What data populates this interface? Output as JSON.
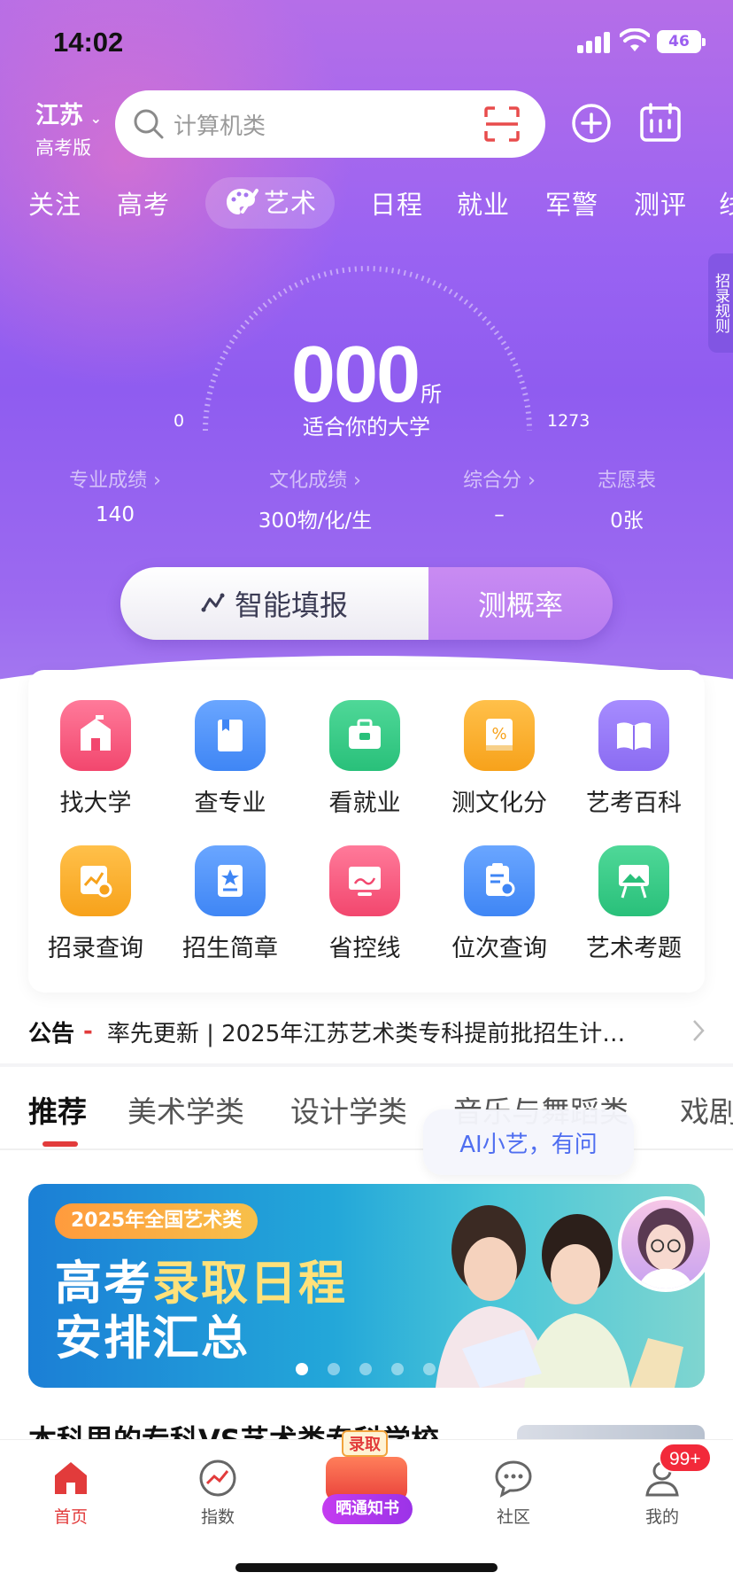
{
  "status_bar": {
    "time": "14:02",
    "battery": "46"
  },
  "header": {
    "region": "江苏",
    "edition": "高考版",
    "search_placeholder": "计算机类"
  },
  "top_tabs": [
    "关注",
    "高考",
    "艺术",
    "日程",
    "就业",
    "军警",
    "测评",
    "线"
  ],
  "active_top_tab": "艺术",
  "side_rule_label": "招录规则",
  "gauge": {
    "count": "000",
    "unit": "所",
    "subtitle": "适合你的大学",
    "min": "0",
    "max": "1273"
  },
  "stats": [
    {
      "label": "专业成绩 ›",
      "value": "140"
    },
    {
      "label": "文化成绩 ›",
      "value": "300物/化/生"
    },
    {
      "label": "综合分 ›",
      "value": "–"
    },
    {
      "label": "志愿表",
      "value": "0张"
    }
  ],
  "cta": {
    "left_label": "智能填报",
    "right_label": "测概率"
  },
  "grid": [
    {
      "label": "找大学",
      "icon": "school-icon",
      "color": "#f2476e"
    },
    {
      "label": "查专业",
      "icon": "book-icon",
      "color": "#3f86f5"
    },
    {
      "label": "看就业",
      "icon": "briefcase-icon",
      "color": "#29c07a"
    },
    {
      "label": "测文化分",
      "icon": "percent-book-icon",
      "color": "#f7a21b"
    },
    {
      "label": "艺考百科",
      "icon": "open-book-icon",
      "color": "#8b6cf2"
    },
    {
      "label": "招录查询",
      "icon": "chart-search-icon",
      "color": "#f7a21b"
    },
    {
      "label": "招生简章",
      "icon": "star-doc-icon",
      "color": "#3f86f5"
    },
    {
      "label": "省控线",
      "icon": "monitor-icon",
      "color": "#f2476e"
    },
    {
      "label": "位次查询",
      "icon": "clipboard-search-icon",
      "color": "#3f86f5"
    },
    {
      "label": "艺术考题",
      "icon": "easel-icon",
      "color": "#29c07a"
    }
  ],
  "notice": {
    "tag": "公告",
    "dash": "-",
    "text": "率先更新 | 2025年江苏艺术类专科提前批招生计…"
  },
  "sub_tabs": [
    "推荐",
    "美术学类",
    "设计学类",
    "音乐与舞蹈类",
    "戏剧"
  ],
  "ai_bubble": "AI小艺，有问",
  "banner": {
    "pill": "2025年全国艺术类",
    "line1_a": "高考",
    "line1_b": "录取日程",
    "line2": "安排汇总"
  },
  "next_item_title": "本科里的专科VS艺术类专科学校",
  "center_ad": {
    "top": "录取",
    "bottom": "晒通知书"
  },
  "tabbar": [
    {
      "label": "首页",
      "icon": "home-icon"
    },
    {
      "label": "指数",
      "icon": "trend-icon"
    },
    {
      "label": "社区",
      "icon": "chat-icon"
    },
    {
      "label": "我的",
      "icon": "user-icon"
    }
  ],
  "badge": "99+",
  "colors": {
    "accent_red": "#e23b3b",
    "hero_purple": "#9a63f2",
    "link_blue": "#4f6ef0"
  }
}
